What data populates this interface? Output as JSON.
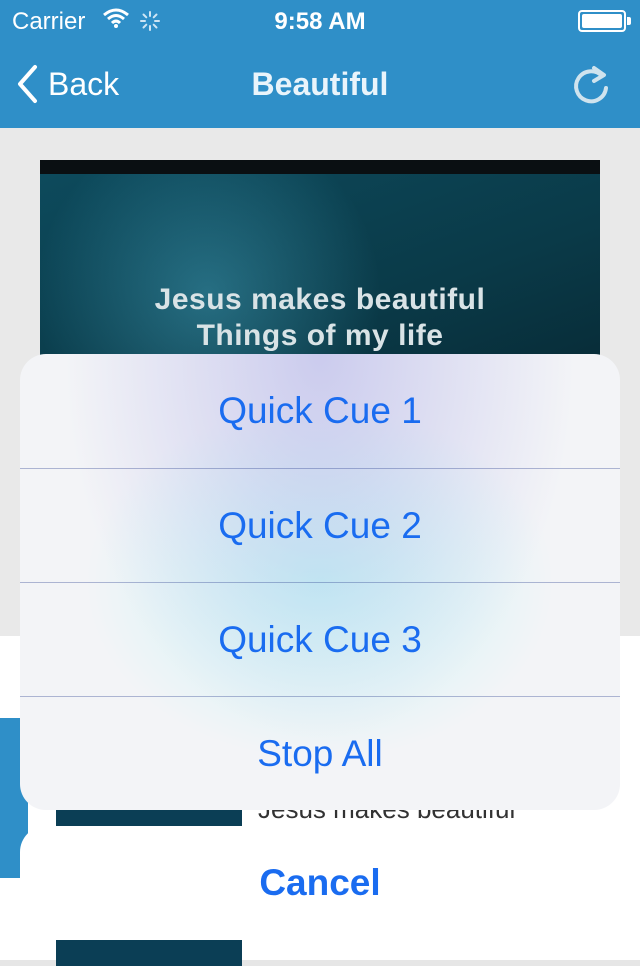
{
  "status_bar": {
    "carrier": "Carrier",
    "time": "9:58 AM"
  },
  "nav": {
    "back_label": "Back",
    "title": "Beautiful"
  },
  "video": {
    "lyric_line_1": "Jesus makes beautiful",
    "lyric_line_2": "Things of my life"
  },
  "list": {
    "item_lyric": "Jesus makes beautiful"
  },
  "action_sheet": {
    "items": [
      {
        "label": "Quick Cue 1"
      },
      {
        "label": "Quick Cue 2"
      },
      {
        "label": "Quick Cue 3"
      },
      {
        "label": "Stop All"
      }
    ],
    "cancel_label": "Cancel"
  },
  "colors": {
    "nav_bar": "#2f8fc8",
    "action_text": "#1a6cf0"
  }
}
